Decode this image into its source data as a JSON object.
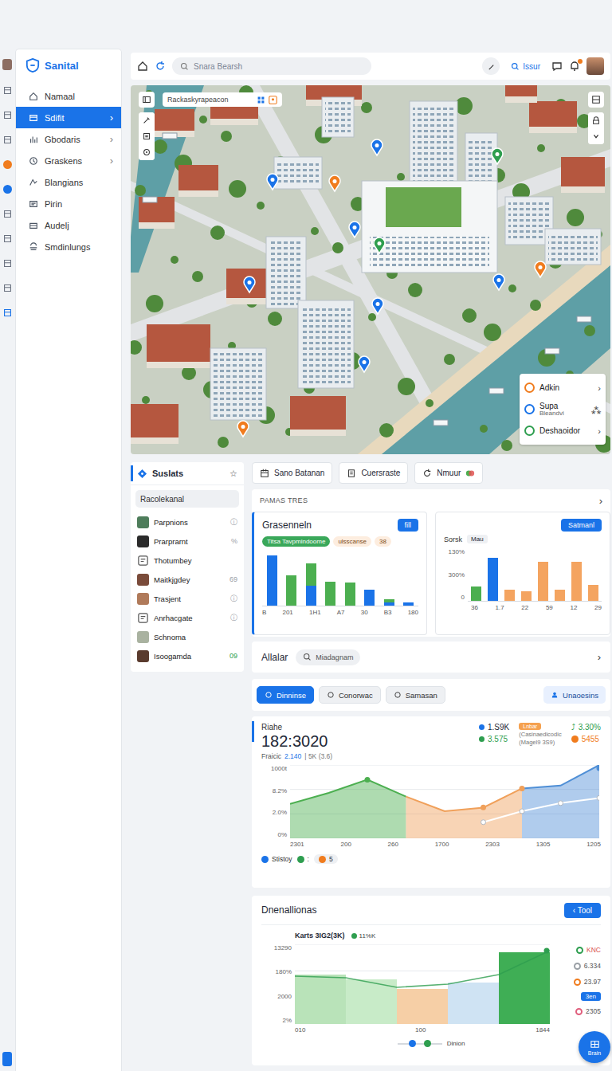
{
  "app": {
    "logo": "Sanital"
  },
  "rail": [
    {
      "kind": "avatar"
    },
    {
      "kind": "icon"
    },
    {
      "kind": "icon"
    },
    {
      "kind": "icon"
    },
    {
      "kind": "dot",
      "color": "#f07c1e"
    },
    {
      "kind": "dot",
      "color": "#1a73e8"
    },
    {
      "kind": "icon"
    },
    {
      "kind": "icon"
    },
    {
      "kind": "icon"
    },
    {
      "kind": "icon"
    },
    {
      "kind": "icon",
      "color": "#1a73e8"
    },
    {
      "kind": "button",
      "color": "#1a73e8"
    }
  ],
  "sidebar": {
    "arrow": "›",
    "items": [
      {
        "label": "Namaal",
        "selected": false,
        "expandable": false
      },
      {
        "label": "Sdifit",
        "selected": true,
        "expandable": true
      },
      {
        "label": "Gbodaris",
        "selected": false,
        "expandable": true
      },
      {
        "label": "Graskens",
        "selected": false,
        "expandable": true
      },
      {
        "label": "Blangians",
        "selected": false,
        "expandable": false
      },
      {
        "label": "Pirin",
        "selected": false,
        "expandable": false
      },
      {
        "label": "Audelj",
        "selected": false,
        "expandable": false
      },
      {
        "label": "Smdinlungs",
        "selected": false,
        "expandable": false
      }
    ]
  },
  "topbar": {
    "search_placeholder": "Snara Bearsh",
    "search_label": "Issur",
    "has_notification": true
  },
  "map": {
    "search": "Rackaskyrapeacon",
    "pins": [
      {
        "color": "#1a73e8"
      },
      {
        "color": "#f07c1e"
      },
      {
        "color": "#1a73e8"
      },
      {
        "color": "#1a73e8"
      },
      {
        "color": "#2e9e4f"
      },
      {
        "color": "#1a73e8"
      },
      {
        "color": "#1a73e8"
      },
      {
        "color": "#1a73e8"
      },
      {
        "color": "#f07c1e"
      },
      {
        "color": "#f07c1e"
      },
      {
        "color": "#1a73e8"
      },
      {
        "color": "#2e9e4f"
      }
    ],
    "legend": [
      {
        "label": "Adkin",
        "trail": "›",
        "color": "#f07c1e"
      },
      {
        "label": "Supa",
        "sub": "Bleandvi",
        "trail": "⁂",
        "color": "#1a73e8"
      },
      {
        "label": "Deshaoidor",
        "trail": "›",
        "color": "#2e9e4f"
      }
    ]
  },
  "people": {
    "title": "Suslats",
    "star": "☆",
    "filter": "Racolekanal",
    "rows": [
      {
        "name": "Parpnions",
        "kind": "photo",
        "trail": "ⓘ",
        "color": "#9aa0a6"
      },
      {
        "name": "Prarprarnt",
        "kind": "photo",
        "trail": "%",
        "color": "#9aa0a6"
      },
      {
        "name": "Thotumbey",
        "kind": "icon"
      },
      {
        "name": "Maitkjgdey",
        "kind": "photo",
        "trail": "69",
        "color": "#9aa0a6"
      },
      {
        "name": "Trasjent",
        "kind": "photo",
        "trail": "ⓘ",
        "color": "#9aa0a6"
      },
      {
        "name": "Anrhacgate",
        "kind": "icon",
        "trail": "ⓘ",
        "color": "#9aa0a6"
      },
      {
        "name": "Schnoma",
        "kind": "photo"
      },
      {
        "name": "Isoogamda",
        "kind": "photo",
        "trail": "09",
        "color": "#2e9e4f"
      }
    ]
  },
  "actions": [
    {
      "label": "Sano Batanan"
    },
    {
      "label": "Cuersraste"
    },
    {
      "label": "Nmuur"
    }
  ],
  "pamas": {
    "title": "PAMAS TRES",
    "arrow": "›",
    "left": {
      "title": "Grasenneln",
      "button": "fill",
      "tags": [
        {
          "label": "Titsa Tavpmindoome",
          "color": "#3aa85a"
        },
        {
          "label": "ulsscanse",
          "color": "#f4a460"
        },
        {
          "label": "38",
          "color": "#f4a460"
        }
      ],
      "series": [
        {
          "color": "#1a73e8",
          "values": [
            95,
            0,
            38,
            0,
            0,
            30,
            6,
            6
          ]
        },
        {
          "color": "#4caf50",
          "values": [
            0,
            58,
            42,
            46,
            44,
            0,
            6,
            0
          ]
        }
      ],
      "x_labels": [
        "B",
        "201",
        "1H1",
        "A7",
        "30",
        "B3",
        "180"
      ]
    },
    "right": {
      "button": "Satmanl",
      "title": "Sorsk",
      "tag": "Mau",
      "y_ticks": [
        "130%",
        "300%",
        "0"
      ],
      "bars": [
        {
          "value": 28,
          "color": "#4caf50"
        },
        {
          "value": 82,
          "color": "#1a73e8"
        },
        {
          "value": 22,
          "color": "#f4a460"
        },
        {
          "value": 18,
          "color": "#f4a460"
        },
        {
          "value": 74,
          "color": "#f4a460"
        },
        {
          "value": 22,
          "color": "#f4a460"
        },
        {
          "value": 74,
          "color": "#f4a460"
        },
        {
          "value": 30,
          "color": "#f4a460"
        }
      ],
      "x_labels": [
        "36",
        "1.7",
        "22",
        "59",
        "12",
        "29"
      ]
    }
  },
  "filter_row": {
    "title": "Allalar",
    "search": "Miadagnam",
    "arrow": "›"
  },
  "tabs": [
    {
      "label": "Dinninse",
      "selected": true
    },
    {
      "label": "Conorwac",
      "selected": false
    },
    {
      "label": "Samasan",
      "selected": false
    }
  ],
  "tabs_action": "Unaoesins",
  "riahe": {
    "title": "Riahe",
    "value": "182:3020",
    "sub_label": "Fraicic",
    "sub_value": "2.140",
    "sub_extra": "| 5K (3.6)",
    "stats": [
      {
        "value": "1.S9K",
        "color": "#1a73e8"
      },
      {
        "value": "3.575",
        "color": "#2e9e4f"
      }
    ],
    "note": {
      "tag": "Lnbar",
      "lines": [
        "(Casinaedicodic",
        "(Magel9 3S9)"
      ]
    },
    "deltas": [
      {
        "value": "3.30%",
        "glyph": "⤴",
        "color": "#2e9e4f"
      },
      {
        "value": "5455",
        "color": "#f07c1e"
      }
    ],
    "y_ticks": [
      "1000t",
      "8.2%",
      "2.0%",
      "0%"
    ],
    "x_labels": [
      "2301",
      "200",
      "260",
      "1700",
      "2303",
      "1305",
      "1205"
    ],
    "main": {
      "values": [
        47,
        62,
        80,
        57,
        37,
        42,
        68,
        72,
        100
      ]
    },
    "secondary": {
      "values": [
        null,
        null,
        null,
        null,
        null,
        22,
        37,
        48,
        55
      ]
    },
    "bands": [
      {
        "from": 0,
        "to": 3,
        "color": "#4caf50"
      },
      {
        "from": 3,
        "to": 6,
        "color": "#f0a05a"
      },
      {
        "from": 6,
        "to": 8,
        "color": "#4f8fd6"
      }
    ],
    "legend": [
      {
        "label": "Stistoy",
        "color": "#1a73e8"
      },
      {
        "label": ":",
        "color": "#2e9e4f"
      },
      {
        "label": "5",
        "color": "#f07c1e"
      }
    ]
  },
  "dnen": {
    "title": "Dnenallionas",
    "button": {
      "glyph": "‹",
      "label": "Tool"
    },
    "chart_title": "Karts 3IG2(3K)",
    "tag": {
      "label": "11%K",
      "color": "#2e9e4f"
    },
    "y_ticks": [
      "13290",
      "180%",
      "2000",
      "2%"
    ],
    "x_labels": [
      "010",
      "100",
      "1844"
    ],
    "columns": [
      {
        "value": 62,
        "color": "#b9e3b9"
      },
      {
        "value": 56,
        "color": "#c8ebc8"
      },
      {
        "value": 44,
        "color": "#f6cfa6"
      },
      {
        "value": 52,
        "color": "#cfe3f3"
      },
      {
        "value": 90,
        "color": "#3fae55"
      }
    ],
    "line": {
      "values": [
        60,
        58,
        46,
        50,
        62,
        92
      ]
    },
    "side": [
      {
        "text": "KNC",
        "color": "#2e9e4f"
      },
      {
        "text": "6.334",
        "color": "#9aa0a6"
      },
      {
        "text": "23.97",
        "color": "#f07c1e"
      },
      {
        "text": "3en",
        "color": "#1a73e8"
      },
      {
        "text": "2305",
        "color": "#e0607e"
      }
    ],
    "legend": {
      "label": "Dinion",
      "dots": [
        "#1a73e8",
        "#2e9e4f"
      ]
    }
  },
  "fab": {
    "label": "Brain"
  }
}
